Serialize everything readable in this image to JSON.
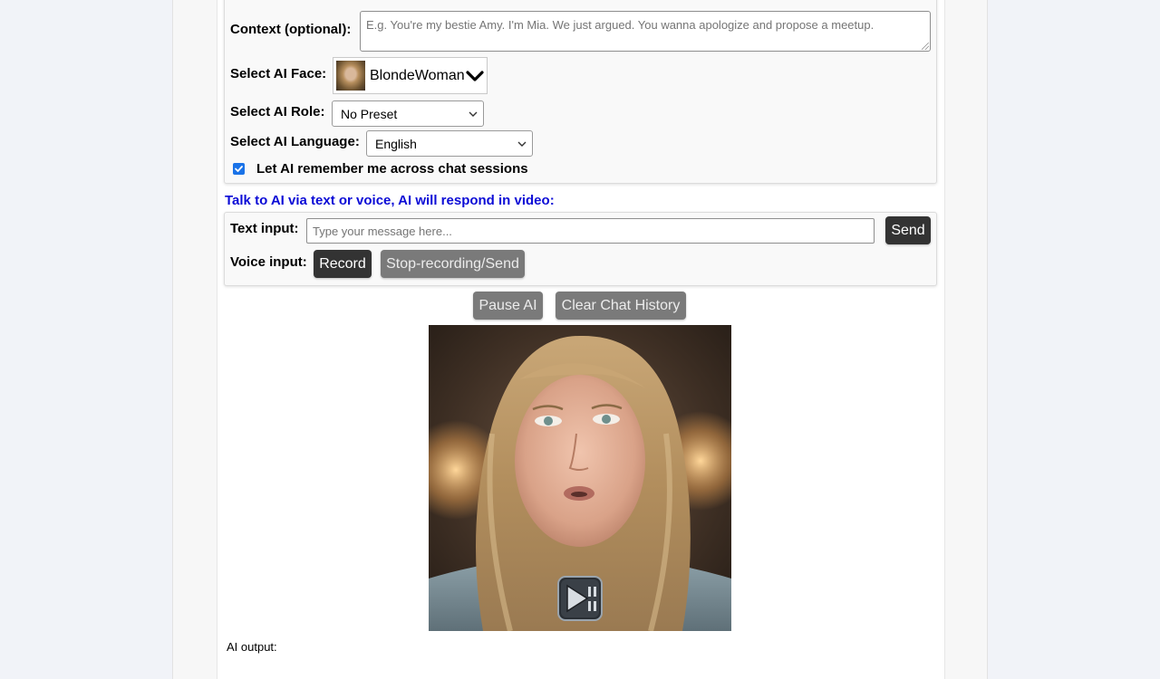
{
  "context": {
    "label": "Context (optional):",
    "placeholder": "E.g. You're my bestie Amy. I'm Mia. We just argued. You wanna apologize and propose a meetup."
  },
  "face": {
    "label": "Select AI Face:",
    "selected": "BlondeWoman"
  },
  "role": {
    "label": "Select AI Role:",
    "selected": "No Preset"
  },
  "language": {
    "label": "Select AI Language:",
    "selected": "English"
  },
  "memory": {
    "label": "Let AI remember me across chat sessions",
    "checked": true
  },
  "talk": {
    "title": "Talk to AI via text or voice, AI will respond in video:",
    "text_label": "Text input:",
    "text_placeholder": "Type your message here...",
    "send_label": "Send",
    "voice_label": "Voice input:",
    "record_label": "Record",
    "stop_label": "Stop-recording/Send"
  },
  "controls": {
    "pause_label": "Pause AI",
    "clear_label": "Clear Chat History"
  },
  "output": {
    "label": "AI output:"
  },
  "colors": {
    "accent_title": "#0b0bd6",
    "dark_button": "#333333",
    "disabled_button": "#7a7a7a",
    "checkbox": "#1a73e8"
  }
}
